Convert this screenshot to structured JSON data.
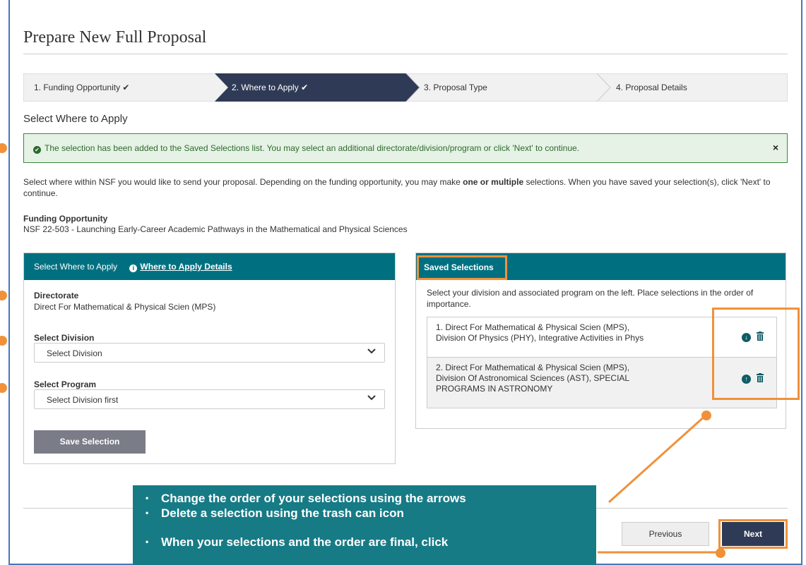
{
  "page": {
    "title": "Prepare New Full Proposal"
  },
  "steps": [
    {
      "label": "1. Funding Opportunity",
      "done": true,
      "active": false
    },
    {
      "label": "2. Where to Apply",
      "done": true,
      "active": true
    },
    {
      "label": "3. Proposal Type",
      "done": false,
      "active": false
    },
    {
      "label": "4. Proposal Details",
      "done": false,
      "active": false
    }
  ],
  "step_check": "✔",
  "section_heading": "Select Where to Apply",
  "alert": {
    "message": "The selection has been added to the Saved Selections list. You may select an additional directorate/division/program or click 'Next' to continue.",
    "close": "×"
  },
  "intro": {
    "part1": "Select where within NSF you would like to send your proposal. Depending on the funding opportunity, you may make ",
    "bold": "one or multiple",
    "part2": " selections. When you have saved your selection(s), click 'Next' to continue."
  },
  "funding_opportunity": {
    "label": "Funding Opportunity",
    "value": "NSF 22-503 - Launching Early-Career Academic Pathways in the Mathematical and Physical Sciences"
  },
  "left_panel": {
    "title": "Select Where to Apply",
    "details_link": "Where to Apply Details",
    "directorate_label": "Directorate",
    "directorate_value": "Direct For Mathematical & Physical Scien (MPS)",
    "division_label": "Select Division",
    "division_value": "Select Division",
    "program_label": "Select Program",
    "program_value": "Select Division first",
    "save_button": "Save Selection"
  },
  "right_panel": {
    "title": "Saved Selections",
    "hint": "Select your division and associated program on the left. Place selections in the order of importance.",
    "selections": [
      {
        "line1": "1. Direct For Mathematical & Physical Scien (MPS),",
        "line2": "Division Of Physics (PHY), Integrative Activities in Phys",
        "line3": "",
        "arrow": "down"
      },
      {
        "line1": "2. Direct For Mathematical & Physical Scien (MPS),",
        "line2": "Division Of Astronomical Sciences (AST), SPECIAL",
        "line3": "PROGRAMS IN ASTRONOMY",
        "arrow": "up"
      }
    ]
  },
  "buttons": {
    "previous": "Previous",
    "next": "Next"
  },
  "callout": {
    "bullets": [
      "Change the order of your selections using the arrows",
      "Delete a selection using the trash can icon",
      "When your selections and the order are final, click"
    ]
  },
  "colors": {
    "accent": "#007080",
    "active_step": "#2f3b56",
    "annotation": "#f0913a",
    "callout_bg": "#177b86",
    "alert_bg": "#e6f2e6"
  }
}
